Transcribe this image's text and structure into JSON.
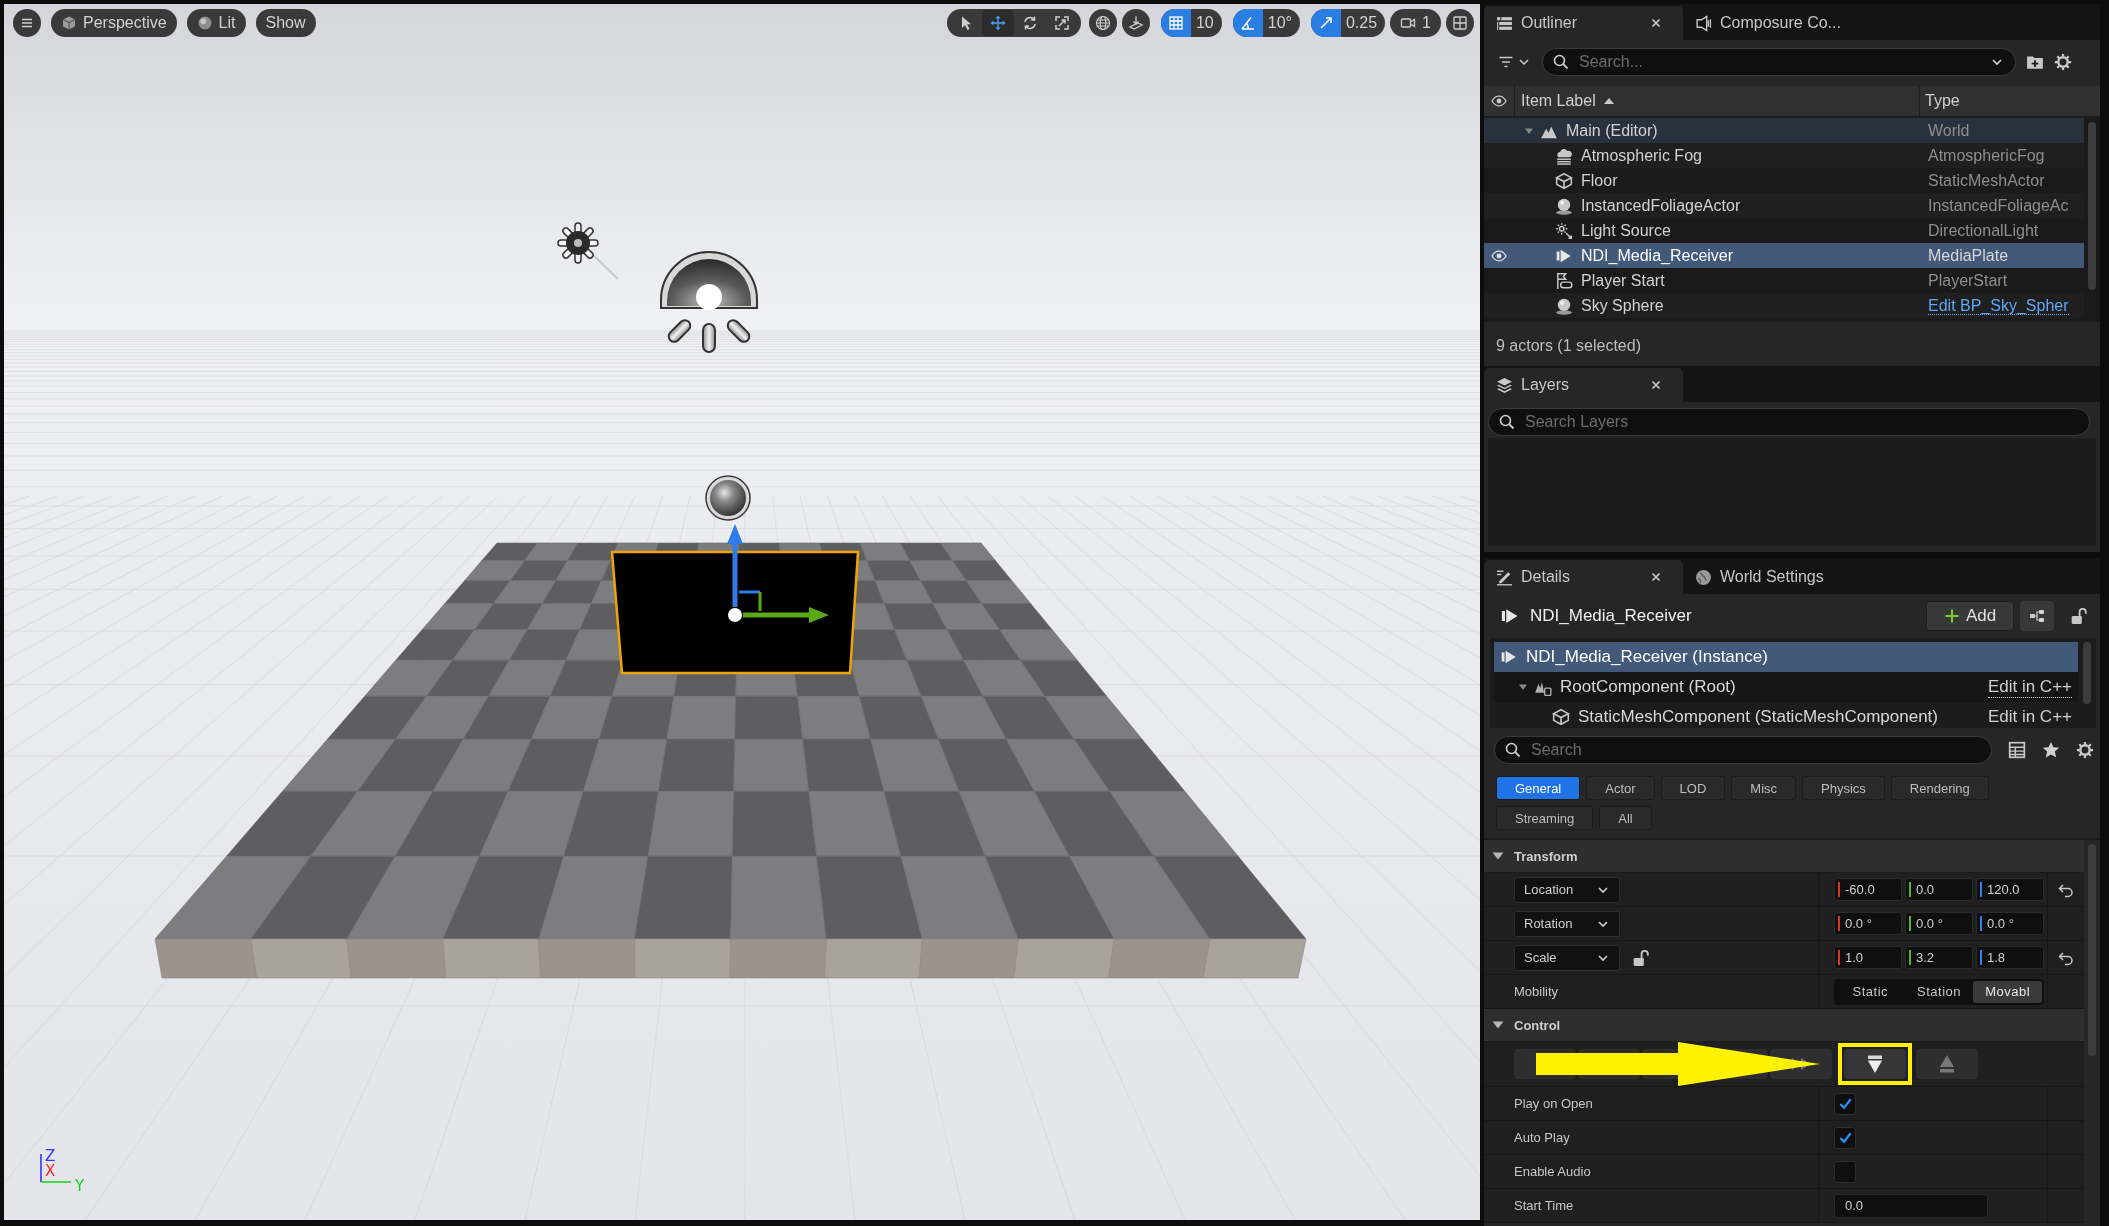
{
  "viewport": {
    "toolbar": {
      "view_mode": "Perspective",
      "lighting": "Lit",
      "show": "Show",
      "tools": [
        {
          "kind": "select",
          "selected": false
        },
        {
          "kind": "move",
          "selected": true
        },
        {
          "kind": "rotate",
          "selected": false
        },
        {
          "kind": "scale",
          "selected": false
        }
      ],
      "snaps": [
        {
          "kind": "grid",
          "value": "10",
          "on": true
        },
        {
          "kind": "angle",
          "value": "10°",
          "on": true
        },
        {
          "kind": "scale",
          "value": "0.25",
          "on": true
        }
      ],
      "camera_speed": "1"
    },
    "axis_labels": [
      "Z",
      "X",
      "Y"
    ]
  },
  "outliner": {
    "tabs": [
      {
        "kind": "outliner",
        "label": "Outliner",
        "selected": true,
        "closable": true
      },
      {
        "kind": "composure",
        "label": "Composure Co...",
        "selected": false,
        "closable": false
      }
    ],
    "search": {
      "placeholder": "Search..."
    },
    "columns": [
      {
        "label": "Item Label",
        "sorted": true
      },
      {
        "label": "Type",
        "sorted": false
      }
    ],
    "rows": [
      {
        "label": "Main (Editor)",
        "type": "World",
        "kind": "world",
        "selected": false,
        "link": false,
        "expanded": true,
        "children": [
          {
            "label": "Atmospheric Fog",
            "type": "AtmosphericFog",
            "kind": "fog",
            "selected": false,
            "link": false
          },
          {
            "label": "Floor",
            "type": "StaticMeshActor",
            "kind": "mesh",
            "selected": false,
            "link": false
          },
          {
            "label": "InstancedFoliageActor",
            "type": "InstancedFoliageAc",
            "kind": "foliage",
            "selected": false,
            "link": false
          },
          {
            "label": "Light Source",
            "type": "DirectionalLight",
            "kind": "light",
            "selected": false,
            "link": false
          },
          {
            "label": "NDI_Media_Receiver",
            "type": "MediaPlate",
            "kind": "media",
            "selected": true,
            "link": false
          },
          {
            "label": "Player Start",
            "type": "PlayerStart",
            "kind": "player",
            "selected": false,
            "link": false
          },
          {
            "label": "Sky Sphere",
            "type": "Edit BP_Sky_Spher",
            "kind": "sky",
            "selected": false,
            "link": true
          }
        ]
      }
    ],
    "status": "9 actors (1 selected)"
  },
  "layers": {
    "tab": {
      "kind": "layers",
      "label": "Layers",
      "selected": true,
      "closable": true
    },
    "search": {
      "placeholder": "Search Layers"
    }
  },
  "details": {
    "tabs": [
      {
        "kind": "details",
        "label": "Details",
        "selected": true,
        "closable": true
      },
      {
        "kind": "world_settings",
        "label": "World Settings",
        "selected": false,
        "closable": false
      }
    ],
    "actor": "NDI_Media_Receiver",
    "add_button": "Add",
    "components": [
      {
        "label": "NDI_Media_Receiver (Instance)",
        "kind": "media",
        "selected": true,
        "children": [
          {
            "label": "RootComponent (Root)",
            "kind": "root",
            "selected": false,
            "expanded": true,
            "action": "Edit in C++",
            "hovered": true,
            "children": [
              {
                "label": "StaticMeshComponent (StaticMeshComponent)",
                "kind": "mesh",
                "selected": false,
                "action": "Edit in C++",
                "hovered": false
              }
            ]
          }
        ]
      }
    ],
    "search": {
      "placeholder": "Search"
    },
    "categories": [
      {
        "label": "General",
        "selected": true
      },
      {
        "label": "Actor",
        "selected": false
      },
      {
        "label": "LOD",
        "selected": false
      },
      {
        "label": "Misc",
        "selected": false
      },
      {
        "label": "Physics",
        "selected": false
      },
      {
        "label": "Rendering",
        "selected": false
      },
      {
        "label": "Streaming",
        "selected": false
      },
      {
        "label": "All",
        "selected": false
      }
    ],
    "sections": [
      {
        "title": "Transform",
        "expanded": true,
        "rows": [
          {
            "kind": "vector",
            "label": "Location",
            "resettable": true,
            "values": [
              {
                "value": "-60.0",
                "color": "#d23a22"
              },
              {
                "value": "0.0",
                "color": "#62b516"
              },
              {
                "value": "120.0",
                "color": "#2f80ea"
              }
            ]
          },
          {
            "kind": "vector",
            "label": "Rotation",
            "resettable": false,
            "values": [
              {
                "value": "0.0 °",
                "color": "#d23a22"
              },
              {
                "value": "0.0 °",
                "color": "#62b516"
              },
              {
                "value": "0.0 °",
                "color": "#2f80ea"
              }
            ]
          },
          {
            "kind": "vector",
            "label": "Scale",
            "resettable": true,
            "ratio_locked": false,
            "values": [
              {
                "value": "1.0",
                "color": "#d23a22"
              },
              {
                "value": "3.2",
                "color": "#62b516"
              },
              {
                "value": "1.8",
                "color": "#2f80ea"
              }
            ]
          },
          {
            "kind": "segmented",
            "label": "Mobility",
            "options": [
              {
                "label": "Static",
                "selected": false
              },
              {
                "label": "Station",
                "selected": false
              },
              {
                "label": "Movabl",
                "selected": true
              }
            ]
          }
        ]
      },
      {
        "title": "Control",
        "expanded": true,
        "rows": [
          {
            "kind": "media_buttons",
            "buttons": [
              {
                "kind": "plain",
                "highlighted": false
              },
              {
                "kind": "plain",
                "highlighted": false
              },
              {
                "kind": "plain",
                "highlighted": false
              },
              {
                "kind": "plain",
                "highlighted": false
              },
              {
                "kind": "fast_forward",
                "highlighted": false
              },
              {
                "kind": "open",
                "highlighted": true
              },
              {
                "kind": "eject",
                "highlighted": false
              }
            ]
          },
          {
            "kind": "checkbox",
            "label": "Play on Open",
            "checked": true
          },
          {
            "kind": "checkbox",
            "label": "Auto Play",
            "checked": true
          },
          {
            "kind": "checkbox",
            "label": "Enable Audio",
            "checked": false
          },
          {
            "kind": "text",
            "label": "Start Time",
            "value": "0.0"
          }
        ]
      }
    ]
  }
}
